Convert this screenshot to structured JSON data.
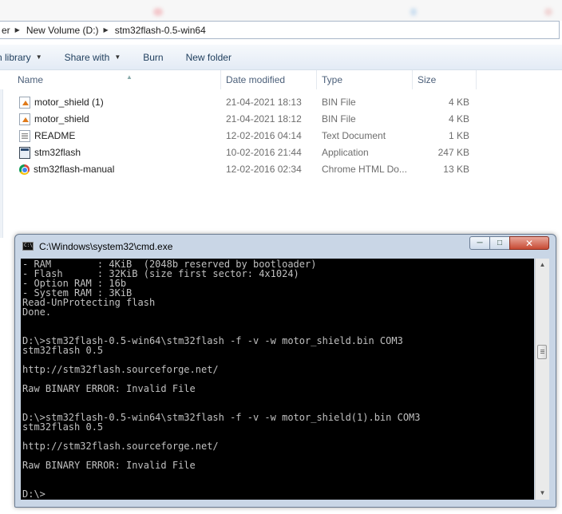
{
  "address_bar": {
    "crumbs": [
      "er",
      "New Volume (D:)",
      "stm32flash-0.5-win64"
    ]
  },
  "toolbar": {
    "include_in_library": "n library",
    "share_with": "Share with",
    "burn": "Burn",
    "new_folder": "New folder"
  },
  "columns": {
    "name": "Name",
    "date_modified": "Date modified",
    "type": "Type",
    "size": "Size"
  },
  "files": [
    {
      "name": "motor_shield (1)",
      "date": "21-04-2021 18:13",
      "type": "BIN File",
      "size": "4 KB",
      "icon": "bin-file-icon"
    },
    {
      "name": "motor_shield",
      "date": "21-04-2021 18:12",
      "type": "BIN File",
      "size": "4 KB",
      "icon": "bin-file-icon"
    },
    {
      "name": "README",
      "date": "12-02-2016 04:14",
      "type": "Text Document",
      "size": "1 KB",
      "icon": "text-document-icon"
    },
    {
      "name": "stm32flash",
      "date": "10-02-2016 21:44",
      "type": "Application",
      "size": "247 KB",
      "icon": "application-icon"
    },
    {
      "name": "stm32flash-manual",
      "date": "12-02-2016 02:34",
      "type": "Chrome HTML Do...",
      "size": "13 KB",
      "icon": "chrome-icon"
    }
  ],
  "cmd_window": {
    "title": "C:\\Windows\\system32\\cmd.exe",
    "console_text": "- RAM        : 4KiB  (2048b reserved by bootloader)\n- Flash      : 32KiB (size first sector: 4x1024)\n- Option RAM : 16b\n- System RAM : 3KiB\nRead-UnProtecting flash\nDone.\n\n\nD:\\>stm32flash-0.5-win64\\stm32flash -f -v -w motor_shield.bin COM3\nstm32flash 0.5\n\nhttp://stm32flash.sourceforge.net/\n\nRaw BINARY ERROR: Invalid File\n\n\nD:\\>stm32flash-0.5-win64\\stm32flash -f -v -w motor_shield(1).bin COM3\nstm32flash 0.5\n\nhttp://stm32flash.sourceforge.net/\n\nRaw BINARY ERROR: Invalid File\n\n\nD:\\>"
  },
  "colors": {
    "console_bg": "#000000",
    "console_fg": "#c0c0c0",
    "toolbar_text": "#1e3d5c",
    "close_button": "#c74a33"
  }
}
